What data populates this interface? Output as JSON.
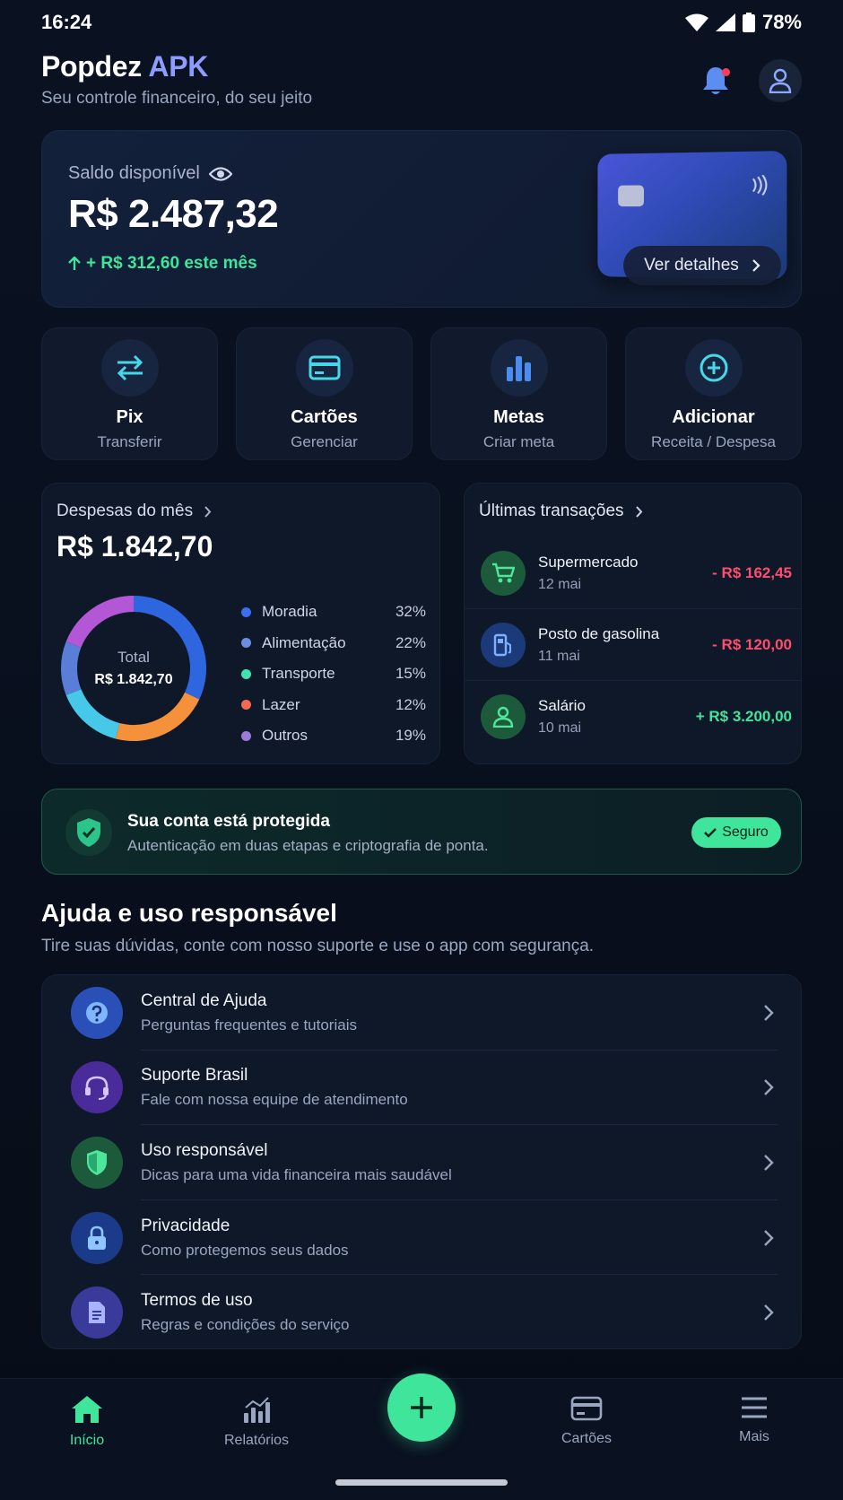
{
  "status": {
    "time": "16:24",
    "battery": "78%"
  },
  "header": {
    "title_main": "Popdez",
    "title_accent": "APK",
    "subtitle": "Seu controle financeiro, do seu jeito"
  },
  "balance": {
    "label": "Saldo disponível",
    "value": "R$ 2.487,32",
    "change": "+ R$ 312,60 este mês",
    "details_button": "Ver detalhes"
  },
  "actions": [
    {
      "title": "Pix",
      "sub": "Transferir",
      "icon": "transfer-icon"
    },
    {
      "title": "Cartões",
      "sub": "Gerenciar",
      "icon": "card-icon"
    },
    {
      "title": "Metas",
      "sub": "Criar meta",
      "icon": "bar-chart-icon"
    },
    {
      "title": "Adicionar",
      "sub": "Receita / Despesa",
      "icon": "plus-circle-icon"
    }
  ],
  "expenses": {
    "title": "Despesas do mês",
    "value": "R$ 1.842,70",
    "donut_label": "Total",
    "donut_total": "R$ 1.842,70",
    "categories": [
      {
        "name": "Moradia",
        "pct": "32%",
        "value": 32,
        "color": "#2e66e0"
      },
      {
        "name": "Alimentação",
        "pct": "22%",
        "value": 22,
        "color": "#f5913a"
      },
      {
        "name": "Transporte",
        "pct": "15%",
        "value": 15,
        "color": "#46c8e8"
      },
      {
        "name": "Lazer",
        "pct": "12%",
        "value": 12,
        "color": "#5a7dd8"
      },
      {
        "name": "Outros",
        "pct": "19%",
        "value": 19,
        "color": "#b357d6"
      }
    ],
    "legend_dot_colors": [
      "#3b6ef0",
      "#6b8fe0",
      "#3ee5b0",
      "#f26a4f",
      "#9b7ad8"
    ]
  },
  "transactions": {
    "title": "Últimas transações",
    "items": [
      {
        "name": "Supermercado",
        "date": "12 mai",
        "amount": "- R$ 162,45",
        "type": "debit",
        "icon": "cart-icon"
      },
      {
        "name": "Posto de gasolina",
        "date": "11 mai",
        "amount": "- R$ 120,00",
        "type": "debit",
        "icon": "fuel-icon"
      },
      {
        "name": "Salário",
        "date": "10 mai",
        "amount": "+ R$ 3.200,00",
        "type": "credit",
        "icon": "user-icon"
      }
    ]
  },
  "security": {
    "title": "Sua conta está protegida",
    "subtitle": "Autenticação em duas etapas e criptografia de ponta.",
    "badge": "Seguro"
  },
  "help": {
    "title": "Ajuda e uso responsável",
    "subtitle": "Tire suas dúvidas, conte com nosso suporte e use o app com segurança.",
    "items": [
      {
        "name": "Central de Ajuda",
        "desc": "Perguntas frequentes e tutoriais",
        "icon": "help-icon"
      },
      {
        "name": "Suporte Brasil",
        "desc": "Fale com nossa equipe de atendimento",
        "icon": "headset-icon"
      },
      {
        "name": "Uso responsável",
        "desc": "Dicas para uma vida financeira mais saudável",
        "icon": "shield-icon"
      },
      {
        "name": "Privacidade",
        "desc": "Como protegemos seus dados",
        "icon": "lock-icon"
      },
      {
        "name": "Termos de uso",
        "desc": "Regras e condições do serviço",
        "icon": "document-icon"
      }
    ]
  },
  "nav": {
    "home": "Início",
    "reports": "Relatórios",
    "cards": "Cartões",
    "more": "Mais"
  },
  "colors": {
    "accent": "#3ee59a",
    "debit": "#ff4d6d",
    "credit": "#3ee59a",
    "brand": "#8e9bff"
  }
}
